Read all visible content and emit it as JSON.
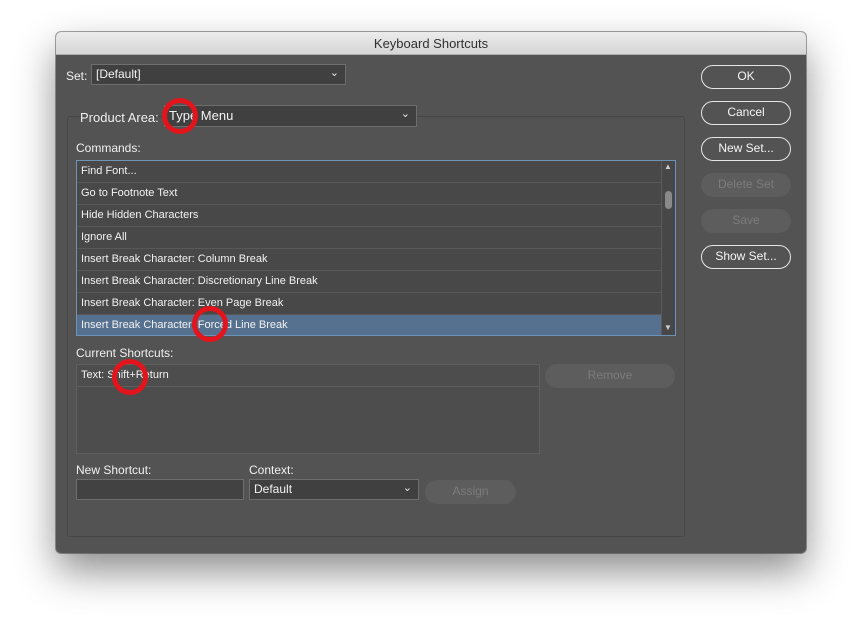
{
  "window": {
    "title": "Keyboard Shortcuts"
  },
  "set": {
    "label": "Set:",
    "value": "[Default]"
  },
  "product_area": {
    "label": "Product Area:",
    "value": "Type Menu"
  },
  "commands": {
    "label": "Commands:",
    "items": [
      "Find Font...",
      "Go to Footnote Text",
      "Hide Hidden Characters",
      "Ignore All",
      "Insert Break Character: Column Break",
      "Insert Break Character: Discretionary Line Break",
      "Insert Break Character: Even Page Break",
      "Insert Break Character: Forced Line Break"
    ],
    "selected_index": 7
  },
  "current_shortcuts": {
    "label": "Current Shortcuts:",
    "items": [
      "Text: Shift+Return"
    ],
    "remove_label": "Remove"
  },
  "new_shortcut": {
    "label": "New Shortcut:",
    "value": ""
  },
  "context": {
    "label": "Context:",
    "value": "Default"
  },
  "assign_label": "Assign",
  "buttons": {
    "ok": "OK",
    "cancel": "Cancel",
    "new_set": "New Set...",
    "delete_set": "Delete Set",
    "save": "Save",
    "show_set": "Show Set..."
  },
  "colors": {
    "dialog_bg": "#535353",
    "selection": "#56718f",
    "annotation": "#e3141b"
  }
}
